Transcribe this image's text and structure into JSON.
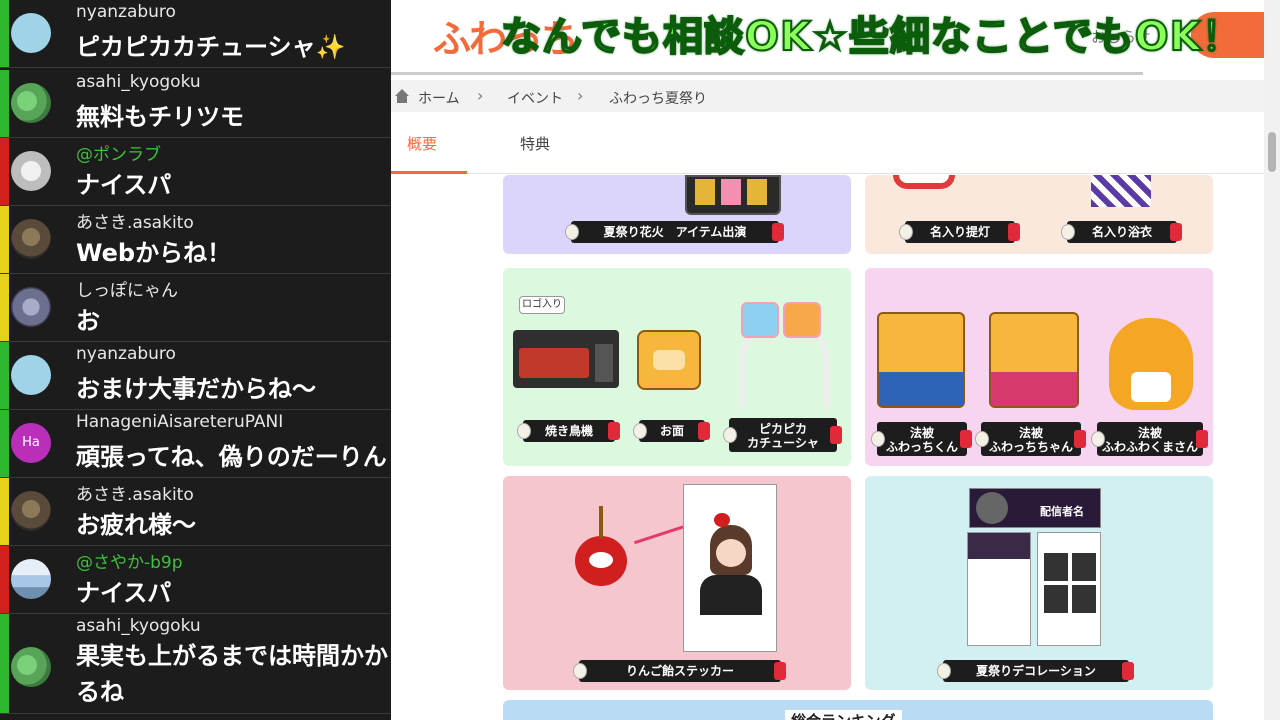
{
  "chat": {
    "messages": [
      {
        "user": "nyanzaburo",
        "text": "ピカピカカチューシャ✨",
        "bar": "#2db82d",
        "avatar": "#9fd3e8",
        "mention": false
      },
      {
        "user": "asahi_kyogoku",
        "text": "無料もチリツモ",
        "bar": "#2db82d",
        "avatar": "#58a55a",
        "mention": false
      },
      {
        "user": "@ポンラブ",
        "text": "ナイスパ",
        "bar": "#d41f1f",
        "avatar": "#d9d9d9",
        "mention": true
      },
      {
        "user": "あさき.asakito",
        "text": "Webからね！",
        "bar": "#e6d21a",
        "avatar": "#5a4a3a",
        "mention": false
      },
      {
        "user": "しっぽにゃん",
        "text": "お",
        "bar": "#e6d21a",
        "avatar": "#6c6f8d",
        "mention": false
      },
      {
        "user": "nyanzaburo",
        "text": "おまけ大事だからね〜",
        "bar": "#2db82d",
        "avatar": "#9fd3e8",
        "mention": false
      },
      {
        "user": "HanageniAisareteruPANI",
        "text": "頑張ってね、偽りのだーりん",
        "bar": "#2db82d",
        "avatar": "#b92fb9",
        "avatar_text": "Ha",
        "mention": false
      },
      {
        "user": "あさき.asakito",
        "text": "お疲れ様〜",
        "bar": "#e6d21a",
        "avatar": "#5a4a3a",
        "mention": false
      },
      {
        "user": "@さやか-b9p",
        "text": "ナイスパ",
        "bar": "#d41f1f",
        "avatar": "#a8c6e6",
        "mention": true
      },
      {
        "user": "asahi_kyogoku",
        "text": "果実も上がるまでは時間かかるね",
        "bar": "#2db82d",
        "avatar": "#58a55a",
        "mention": false
      }
    ]
  },
  "page": {
    "logo": "ふわっち",
    "banner_green": "なんでも相談OK☆些細なことでもOK！",
    "nav_right": "おしらせ",
    "breadcrumb": [
      "ホーム",
      "イベント",
      "ふわっち夏祭り"
    ],
    "tabs": [
      "概要",
      "特典"
    ],
    "cards": {
      "top_left_label": "夏祭り花火　アイテム出演",
      "top_right_labels": [
        "名入り提灯",
        "名入り浴衣"
      ],
      "middle_left_labels": [
        "焼き鳥機",
        "お面",
        "ピカピカ\nカチューシャ"
      ],
      "middle_left_tag": "ロゴ入り",
      "middle_right_labels": [
        "法被\nふわっちくん",
        "法被\nふわっちちゃん",
        "法被\nふわふわくまさん"
      ],
      "bottom_left_label": "りんご飴ステッカー",
      "bottom_right_label": "夏祭りデコレーション",
      "bottom_right_banner": "配信者名"
    },
    "ranking_title": "総合ランキング"
  },
  "colors": {
    "accent": "#f26b3a",
    "card_purple": "#dcd5fb",
    "card_peach": "#fbe8dc",
    "card_mint": "#dcf8df",
    "card_pink": "#f7d4ef",
    "card_rose": "#f5c6cd",
    "card_cyan": "#d2f0f1",
    "card_blue": "#b9dbf4"
  }
}
